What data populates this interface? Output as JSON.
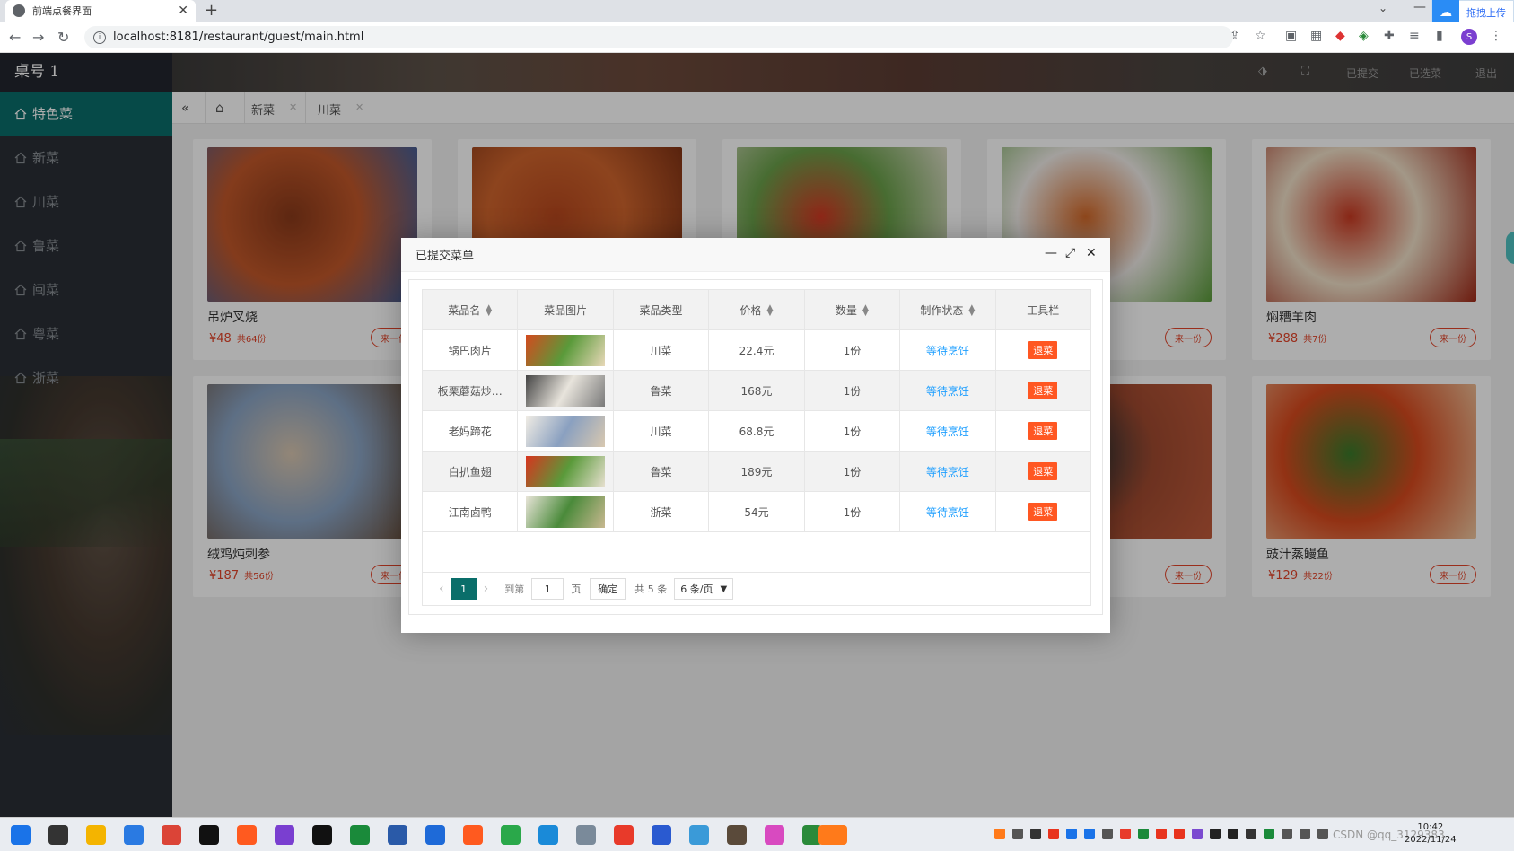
{
  "browser": {
    "tab_title": "前端点餐界面",
    "url": "localhost:8181/restaurant/guest/main.html",
    "baidu_label": "拖拽上传",
    "profile_initial": "S"
  },
  "app": {
    "logo": "桌号 1",
    "menu": [
      {
        "label": "特色菜",
        "active": true
      },
      {
        "label": "新菜"
      },
      {
        "label": "川菜"
      },
      {
        "label": "鲁菜"
      },
      {
        "label": "闽菜"
      },
      {
        "label": "粤菜"
      },
      {
        "label": "浙菜"
      }
    ],
    "header_links": [
      "已提交",
      "已选菜",
      "退出"
    ],
    "page_tabs": [
      "新菜",
      "川菜"
    ]
  },
  "cards": [
    {
      "name": "吊炉叉烧",
      "price": "¥48",
      "sold": "共64份",
      "button": "来一份",
      "colors": [
        "#8a3a1a",
        "#c2582a",
        "#3a5fa0"
      ]
    },
    {
      "name": "",
      "price": "",
      "sold": "",
      "button": "",
      "colors": [
        "#b8481e",
        "#d0652d",
        "#7a2e12"
      ]
    },
    {
      "name": "",
      "price": "",
      "sold": "",
      "button": "",
      "colors": [
        "#d43a24",
        "#6aa04a",
        "#e8e2d4"
      ]
    },
    {
      "name": "",
      "price": "",
      "sold": "",
      "button": "来一份",
      "colors": [
        "#d46a2a",
        "#f0ece8",
        "#5a9a3a"
      ]
    },
    {
      "name": "焖糟羊肉",
      "price": "¥288",
      "sold": "共7份",
      "button": "来一份",
      "colors": [
        "#c93a22",
        "#f0e0c8",
        "#a02a18"
      ]
    },
    {
      "name": "绒鸡炖刺参",
      "price": "¥187",
      "sold": "共56份",
      "button": "来一份",
      "colors": [
        "#d8c6b0",
        "#8aa4c4",
        "#6a4a30"
      ]
    },
    {
      "name": "",
      "price": "",
      "sold": "",
      "button": "",
      "colors": [
        "#555",
        "#666",
        "#777"
      ]
    },
    {
      "name": "",
      "price": "",
      "sold": "",
      "button": "",
      "colors": [
        "#555",
        "#666",
        "#777"
      ]
    },
    {
      "name": "",
      "price": "",
      "sold": "",
      "button": "来一份",
      "colors": [
        "#3a3a3a",
        "#a04a30",
        "#c05a3a"
      ]
    },
    {
      "name": "豉汁蒸鳗鱼",
      "price": "¥129",
      "sold": "共22份",
      "button": "来一份",
      "colors": [
        "#3a7a2a",
        "#d84a1e",
        "#f0c8a0"
      ]
    }
  ],
  "modal": {
    "title": "已提交菜单",
    "columns": [
      "菜品名",
      "菜品图片",
      "菜品类型",
      "价格",
      "数量",
      "制作状态",
      "工具栏"
    ],
    "rows": [
      {
        "name": "锅巴肉片",
        "type": "川菜",
        "price": "22.4元",
        "qty": "1份",
        "status": "等待烹饪",
        "action": "退菜",
        "img": [
          "#d44a1e",
          "#5a9a3a",
          "#e8d8b8"
        ]
      },
      {
        "name": "板栗蘑菇炒…",
        "type": "鲁菜",
        "price": "168元",
        "qty": "1份",
        "status": "等待烹饪",
        "action": "退菜",
        "img": [
          "#444",
          "#e8e4dc",
          "#7a7a7a"
        ]
      },
      {
        "name": "老妈蹄花",
        "type": "川菜",
        "price": "68.8元",
        "qty": "1份",
        "status": "等待烹饪",
        "action": "退菜",
        "img": [
          "#f0ece4",
          "#8aa0c0",
          "#d8c8b0"
        ]
      },
      {
        "name": "白扒鱼翅",
        "type": "鲁菜",
        "price": "189元",
        "qty": "1份",
        "status": "等待烹饪",
        "action": "退菜",
        "img": [
          "#d8341e",
          "#5a9a3a",
          "#e8e0d0"
        ]
      },
      {
        "name": "江南卤鸭",
        "type": "浙菜",
        "price": "54元",
        "qty": "1份",
        "status": "等待烹饪",
        "action": "退菜",
        "img": [
          "#e8e4d8",
          "#4a8a3a",
          "#c8b890"
        ]
      }
    ],
    "pager": {
      "current": "1",
      "goto_label": "到第",
      "page_input": "1",
      "page_unit": "页",
      "ok": "确定",
      "total": "共 5 条",
      "per_page": "6 条/页"
    }
  },
  "taskbar": {
    "time": "10:42",
    "date": "2022/11/24",
    "watermark": "CSDN @qq_3129383"
  }
}
